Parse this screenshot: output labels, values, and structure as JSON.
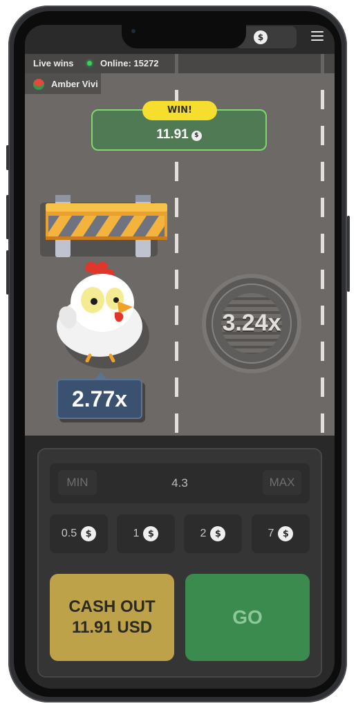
{
  "header": {
    "balance_icon": "dollar-coin-icon",
    "menu_icon": "hamburger-menu-icon"
  },
  "live": {
    "label": "Live wins",
    "online_text": "Online: 15272",
    "winner_name": "Amber Vivi",
    "status_color": "#36d25a"
  },
  "win_popup": {
    "badge": "WIN!",
    "amount": "11.91",
    "coin_symbol": "$"
  },
  "road": {
    "chicken_multiplier": "2.77x",
    "manhole_multiplier": "3.24x",
    "obstacle": "striped-road-barrier"
  },
  "controls": {
    "min_label": "MIN",
    "max_label": "MAX",
    "bet_value": "4.3",
    "coin_symbol": "$",
    "chips": [
      "0.5",
      "1",
      "2",
      "7"
    ],
    "cashout_line1": "CASH OUT",
    "cashout_line2": "11.91 USD",
    "go_label": "GO"
  },
  "colors": {
    "road": "#6c6966",
    "cashout": "#bda24a",
    "go": "#3a8b4d",
    "win_badge": "#f6de2e",
    "multiplier_tag": "#3b5170"
  }
}
